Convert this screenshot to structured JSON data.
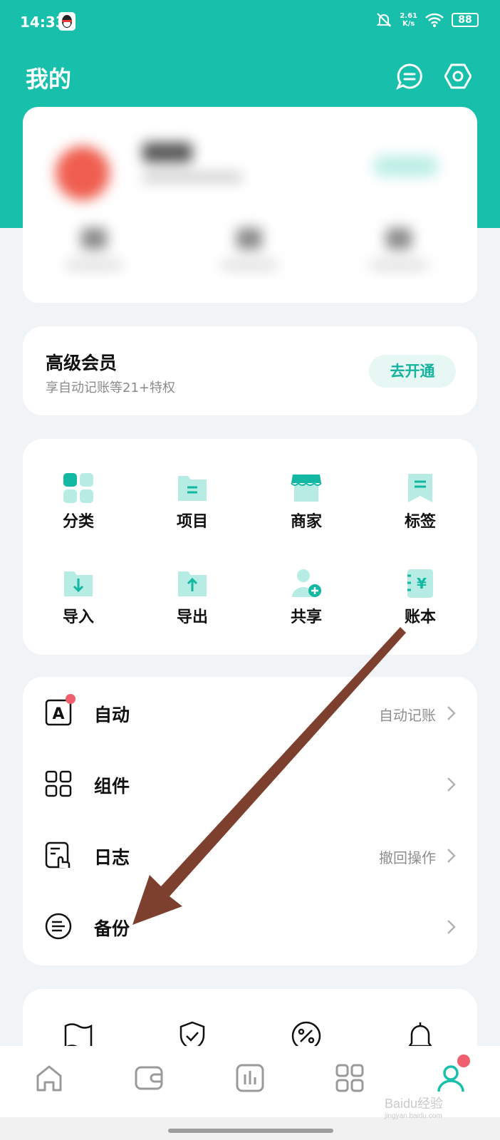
{
  "status_bar": {
    "time": "14:33",
    "net_speed_value": "2.61",
    "net_speed_unit": "K/s",
    "battery": "88"
  },
  "header": {
    "title": "我的"
  },
  "vip": {
    "title": "高级会员",
    "subtitle": "享自动记账等21+特权",
    "button": "去开通"
  },
  "grid": {
    "row1": [
      "分类",
      "项目",
      "商家",
      "标签"
    ],
    "row2": [
      "导入",
      "导出",
      "共享",
      "账本"
    ]
  },
  "list": [
    {
      "label": "自动",
      "value": "自动记账",
      "icon": "auto-icon",
      "dot": true
    },
    {
      "label": "组件",
      "value": "",
      "icon": "widget-icon",
      "dot": false
    },
    {
      "label": "日志",
      "value": "撤回操作",
      "icon": "log-icon",
      "dot": false
    },
    {
      "label": "备份",
      "value": "",
      "icon": "backup-icon",
      "dot": false
    }
  ],
  "colors": {
    "accent": "#18c0ac",
    "icon_light": "#b6ece4",
    "icon_dark": "#13b8a2",
    "badge": "#ef5f6d",
    "arrow": "#7d3f2e"
  },
  "watermark": "Baidu经验",
  "watermark_url": "jingyan.baidu.com"
}
